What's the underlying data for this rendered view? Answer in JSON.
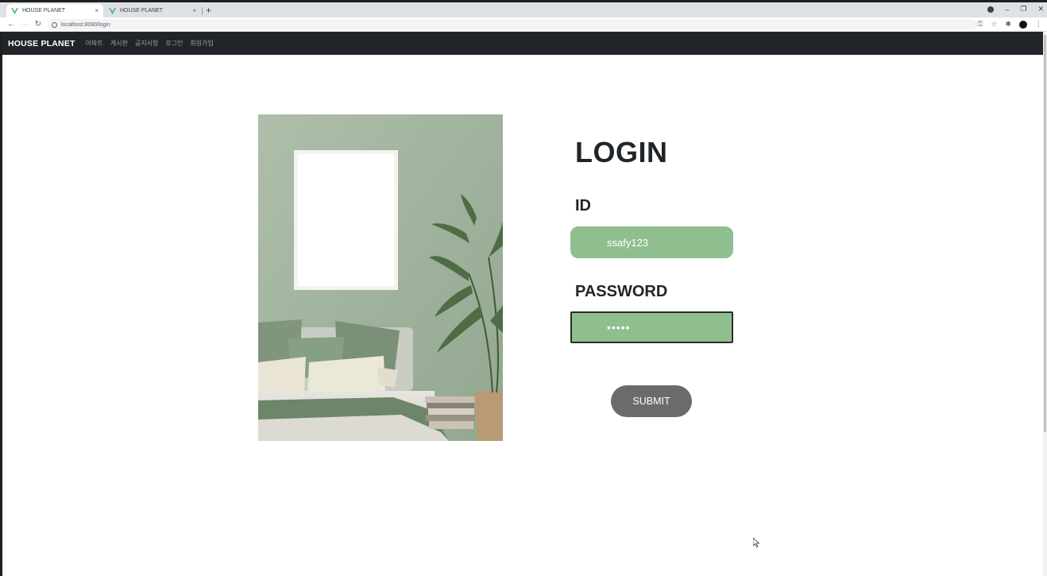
{
  "browser": {
    "tabs": [
      {
        "title": "HOUSE PLANET",
        "close": "×",
        "active": true
      },
      {
        "title": "HOUSE PLANET",
        "close": "×",
        "active": false
      }
    ],
    "new_tab": "+",
    "url": "localhost:8080/login",
    "window_controls": {
      "minimize": "–",
      "restore": "❐",
      "close": "✕"
    }
  },
  "navbar": {
    "brand": "HOUSE PLANET",
    "links": [
      "아파트",
      "게시판",
      "공지사항",
      "로그인",
      "회원가입"
    ]
  },
  "login": {
    "title": "LOGIN",
    "id_label": "ID",
    "id_value": "ssafy123",
    "password_label": "PASSWORD",
    "password_value": "•••••",
    "submit_label": "SUBMIT"
  },
  "colors": {
    "navbar_bg": "#212529",
    "field_bg": "#8fbf8f",
    "submit_bg": "#6b6b6b",
    "photo_wall": "#a9baa6"
  }
}
